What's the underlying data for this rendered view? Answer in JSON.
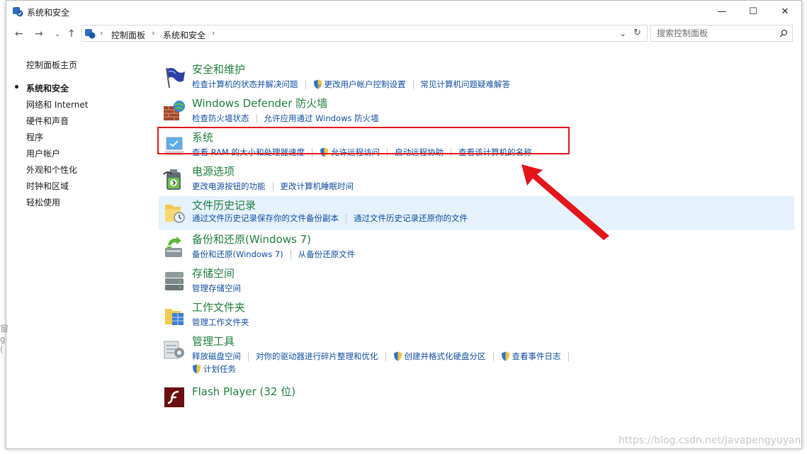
{
  "window": {
    "title": "系统和安全"
  },
  "controls": {
    "minimize": "—",
    "maximize": "☐",
    "close": "✕"
  },
  "address": {
    "crumbs": [
      "控制面板",
      "系统和安全"
    ],
    "search_placeholder": "搜索控制面板"
  },
  "left_nav": {
    "home": "控制面板主页",
    "items": [
      "系统和安全",
      "网络和 Internet",
      "硬件和声音",
      "程序",
      "用户帐户",
      "外观和个性化",
      "时钟和区域",
      "轻松使用"
    ],
    "active": "系统和安全"
  },
  "categories": [
    {
      "title": "安全和维护",
      "icon": "flag-icon",
      "links": [
        {
          "text": "检查计算机的状态并解决问题",
          "shield": false
        },
        {
          "text": "更改用户帐户控制设置",
          "shield": true
        },
        {
          "text": "常见计算机问题疑难解答",
          "shield": false
        }
      ]
    },
    {
      "title": "Windows Defender 防火墙",
      "icon": "firewall-icon",
      "links": [
        {
          "text": "检查防火墙状态",
          "shield": false
        },
        {
          "text": "允许应用通过 Windows 防火墙",
          "shield": false
        }
      ]
    },
    {
      "title": "系统",
      "icon": "system-monitor-icon",
      "links": [
        {
          "text": "查看 RAM 的大小和处理器速度",
          "shield": false
        },
        {
          "text": "允许远程访问",
          "shield": true
        },
        {
          "text": "启动远程协助",
          "shield": false
        },
        {
          "text": "查看该计算机的名称",
          "shield": false
        }
      ]
    },
    {
      "title": "电源选项",
      "icon": "power-battery-icon",
      "links": [
        {
          "text": "更改电源按钮的功能",
          "shield": false
        },
        {
          "text": "更改计算机睡眠时间",
          "shield": false
        }
      ]
    },
    {
      "title": "文件历史记录",
      "icon": "file-history-icon",
      "links": [
        {
          "text": "通过文件历史记录保存你的文件备份副本",
          "shield": false
        },
        {
          "text": "通过文件历史记录还原你的文件",
          "shield": false
        }
      ]
    },
    {
      "title": "备份和还原(Windows 7)",
      "icon": "backup-restore-icon",
      "links": [
        {
          "text": "备份和还原(Windows 7)",
          "shield": false
        },
        {
          "text": "从备份还原文件",
          "shield": false
        }
      ]
    },
    {
      "title": "存储空间",
      "icon": "storage-spaces-icon",
      "links": [
        {
          "text": "管理存储空间",
          "shield": false
        }
      ]
    },
    {
      "title": "工作文件夹",
      "icon": "work-folders-icon",
      "links": [
        {
          "text": "管理工作文件夹",
          "shield": false
        }
      ]
    },
    {
      "title": "管理工具",
      "icon": "admin-tools-icon",
      "links": [
        {
          "text": "释放磁盘空间",
          "shield": false
        },
        {
          "text": "对你的驱动器进行碎片整理和优化",
          "shield": false
        },
        {
          "text": "创建并格式化硬盘分区",
          "shield": true
        },
        {
          "text": "查看事件日志",
          "shield": true
        }
      ],
      "links2": [
        {
          "text": "计划任务",
          "shield": true
        }
      ]
    },
    {
      "title": "Flash Player (32 位)",
      "icon": "flash-player-icon",
      "links": []
    }
  ],
  "watermark": "https://blog.csdn.net/Javapengyuyan",
  "colors": {
    "title_green": "#1e7f3c",
    "link_blue": "#0f4ea0",
    "highlight": "#e5f1fb",
    "annotation_red": "#e3141a"
  }
}
